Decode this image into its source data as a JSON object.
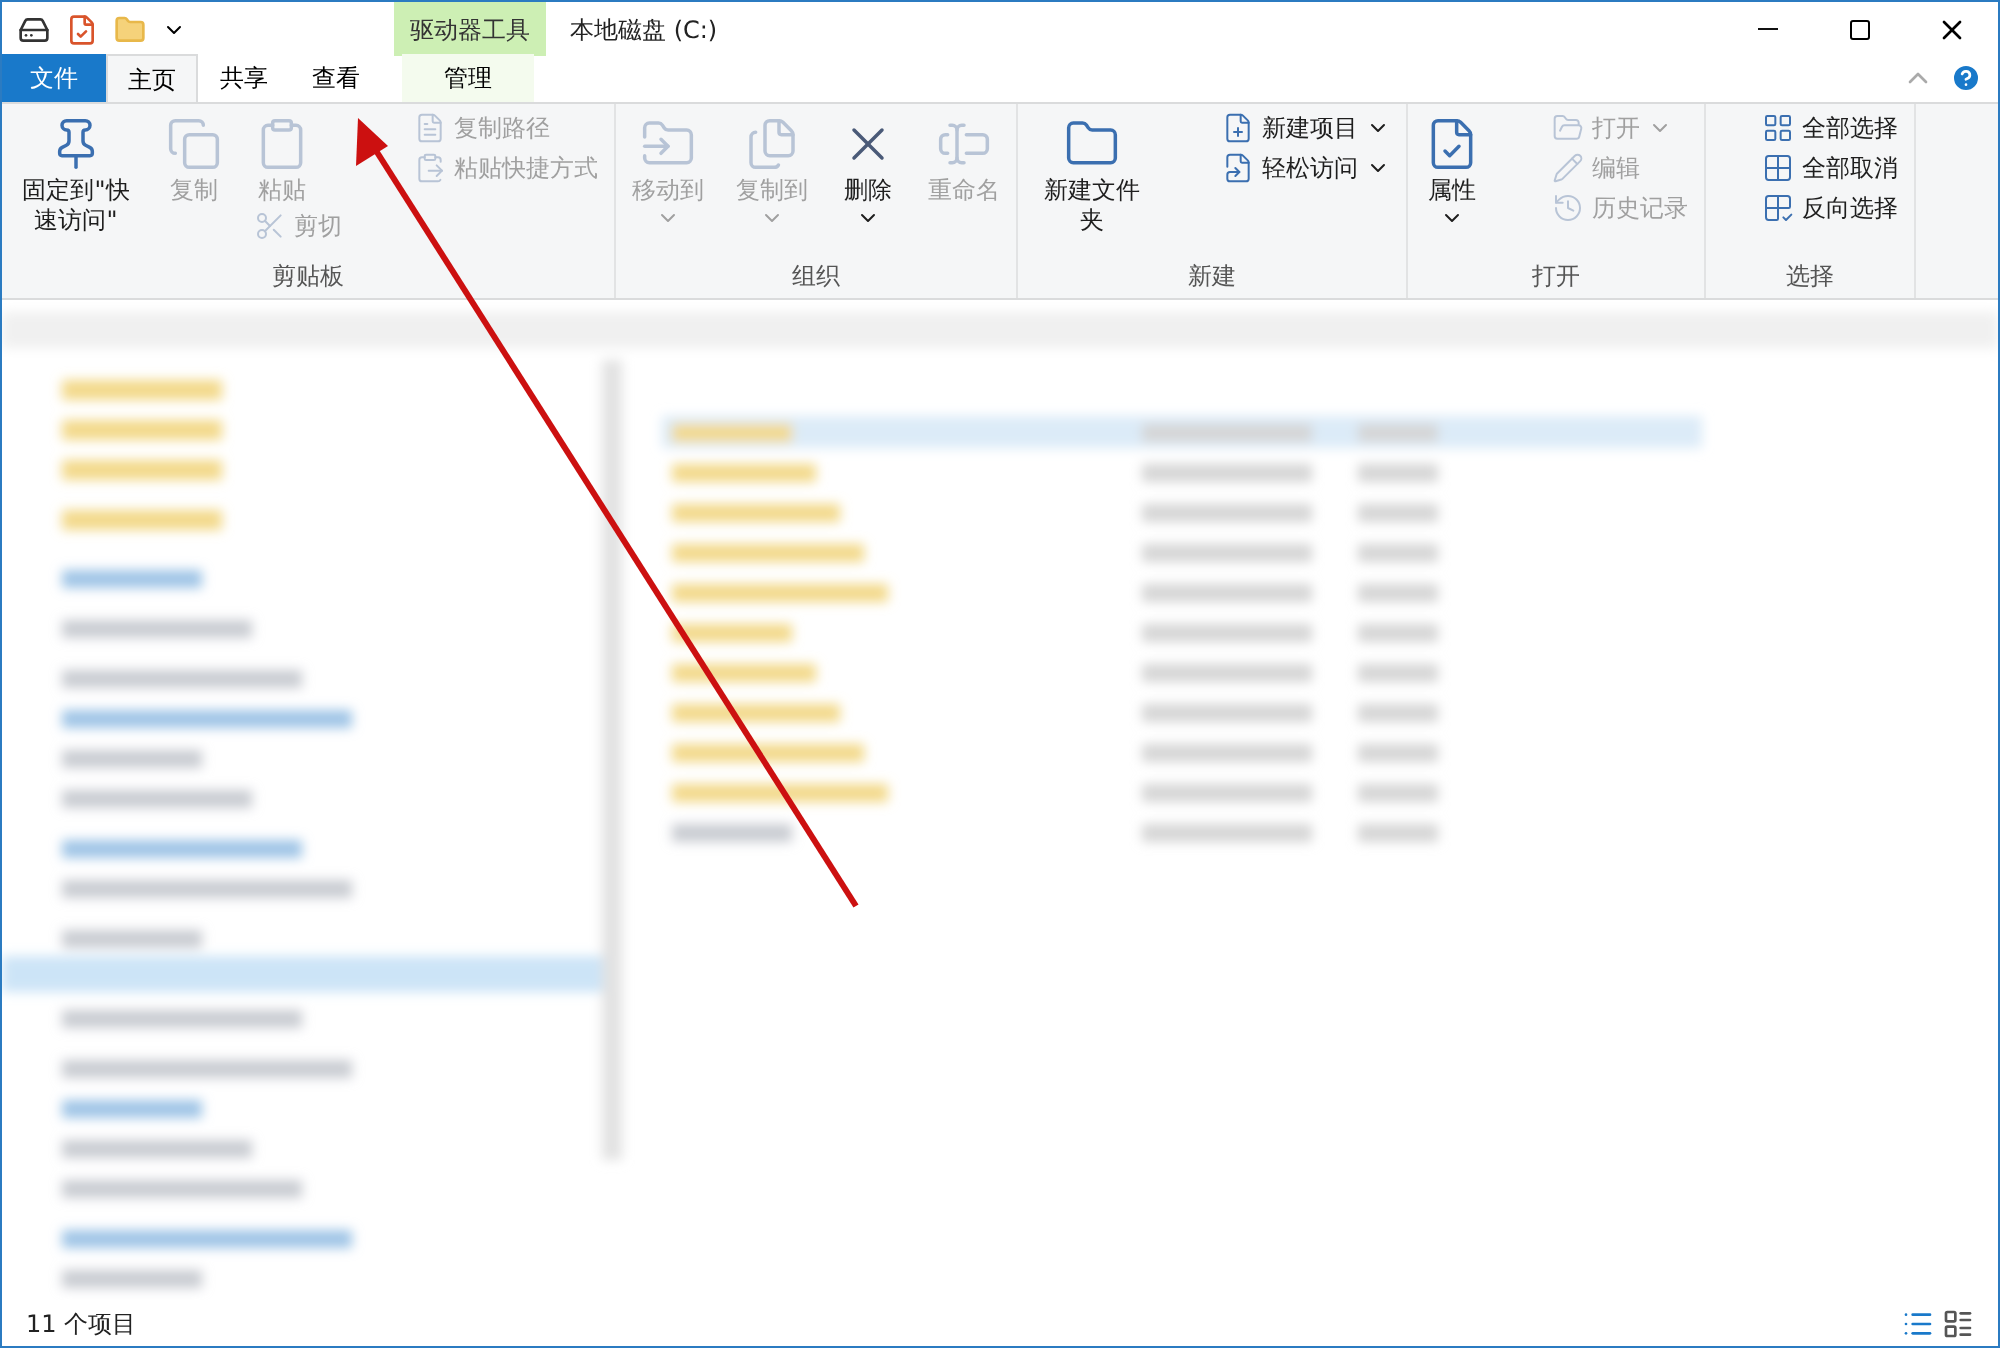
{
  "window": {
    "title": "本地磁盘 (C:)",
    "context_header": "驱动器工具"
  },
  "tabs": [
    {
      "label": "文件",
      "kind": "file",
      "selected": false
    },
    {
      "label": "主页",
      "kind": "tab",
      "selected": true
    },
    {
      "label": "共享",
      "kind": "tab",
      "selected": false
    },
    {
      "label": "查看",
      "kind": "tab",
      "selected": false
    },
    {
      "label": "管理",
      "kind": "context",
      "selected": false
    }
  ],
  "ribbon": [
    {
      "name": "剪贴板",
      "columns": [
        [
          {
            "label": "固定到\"快速访问\"",
            "kind": "large",
            "disabled": false
          }
        ],
        [
          {
            "label": "复制",
            "kind": "large",
            "disabled": true
          }
        ],
        [
          {
            "label": "粘贴",
            "kind": "large",
            "disabled": true
          },
          {
            "label": "剪切",
            "kind": "small",
            "disabled": true
          }
        ],
        [
          {
            "label": "复制路径",
            "kind": "small",
            "disabled": true
          },
          {
            "label": "粘贴快捷方式",
            "kind": "small",
            "disabled": true
          }
        ]
      ]
    },
    {
      "name": "组织",
      "columns": [
        [
          {
            "label": "移动到",
            "kind": "large",
            "disabled": true,
            "dropdown": true
          }
        ],
        [
          {
            "label": "复制到",
            "kind": "large",
            "disabled": true,
            "dropdown": true
          }
        ],
        [
          {
            "label": "删除",
            "kind": "large",
            "disabled": false,
            "dropdown": true
          }
        ],
        [
          {
            "label": "重命名",
            "kind": "large",
            "disabled": true
          }
        ]
      ]
    },
    {
      "name": "新建",
      "columns": [
        [
          {
            "label": "新建文件夹",
            "kind": "large",
            "disabled": false
          }
        ],
        [
          {
            "label": "新建项目",
            "kind": "small",
            "disabled": false,
            "dropdown": true
          },
          {
            "label": "轻松访问",
            "kind": "small",
            "disabled": false,
            "dropdown": true
          }
        ]
      ]
    },
    {
      "name": "打开",
      "columns": [
        [
          {
            "label": "属性",
            "kind": "large",
            "disabled": false,
            "dropdown": true
          }
        ],
        [
          {
            "label": "打开",
            "kind": "small",
            "disabled": true,
            "dropdown": true
          },
          {
            "label": "编辑",
            "kind": "small",
            "disabled": true
          },
          {
            "label": "历史记录",
            "kind": "small",
            "disabled": true
          }
        ]
      ]
    },
    {
      "name": "选择",
      "columns": [
        [
          {
            "label": "全部选择",
            "kind": "small",
            "disabled": false
          },
          {
            "label": "全部取消",
            "kind": "small",
            "disabled": false
          },
          {
            "label": "反向选择",
            "kind": "small",
            "disabled": false
          }
        ]
      ]
    }
  ],
  "status_bar": {
    "item_count": "11 个项目"
  }
}
